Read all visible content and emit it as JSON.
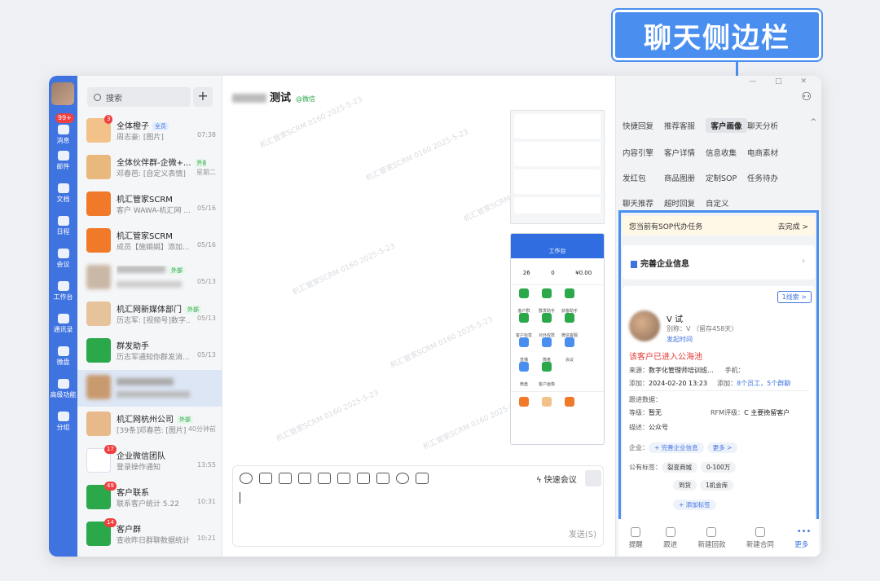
{
  "callout": "聊天侧边栏",
  "nav": {
    "badge": "99+",
    "items": [
      "消息",
      "邮件",
      "文档",
      "日程",
      "会议",
      "工作台",
      "通讯录",
      "微盘",
      "高级功能",
      "分组"
    ]
  },
  "chatlist": {
    "search_placeholder": "搜索",
    "plus": "+",
    "conversations": [
      {
        "name": "全体橙子",
        "tag": "全员",
        "preview": "周志豪: [图片]",
        "time": "07:38",
        "badge": "3"
      },
      {
        "name": "全体伙伴群-企微+...",
        "tag": "外部",
        "preview": "邓春芭: [自定义表情]",
        "time": "星期二",
        "badge": ""
      },
      {
        "name": "机汇管家SCRM",
        "tag": "",
        "preview": "客户 WAWA-机汇网 ...",
        "time": "05/16",
        "badge": ""
      },
      {
        "name": "机汇管家SCRM",
        "tag": "",
        "preview": "成员【施娟娟】添加...",
        "time": "05/16",
        "badge": ""
      },
      {
        "name": "",
        "tag": "外部",
        "preview": "",
        "time": "05/13",
        "badge": ""
      },
      {
        "name": "机汇网新媒体部门",
        "tag": "外部",
        "preview": "历志军: [视频号]数字...",
        "time": "05/13",
        "badge": ""
      },
      {
        "name": "群发助手",
        "tag": "",
        "preview": "历志军通知你群发消...",
        "time": "05/13",
        "badge": ""
      },
      {
        "name": "",
        "tag": "",
        "preview": "",
        "time": "",
        "badge": ""
      },
      {
        "name": "机汇网杭州公司",
        "tag": "外部",
        "preview": "[39条]邓春芭: [图片]",
        "time": "40分钟前",
        "badge": ""
      },
      {
        "name": "企业微信团队",
        "tag": "",
        "preview": "登录操作通知",
        "time": "13:55",
        "badge": "17"
      },
      {
        "name": "客户联系",
        "tag": "",
        "preview": "联系客户统计 5.22",
        "time": "10:31",
        "badge": "49"
      },
      {
        "name": "客户群",
        "tag": "",
        "preview": "查收昨日群聊数据统计",
        "time": "10:21",
        "badge": "14"
      }
    ]
  },
  "chat": {
    "title": "测试",
    "source": "@微信",
    "watermark": "机汇管家SCRM 0160 2025-5-23",
    "phone_header": "工作台",
    "phone_stats": [
      "26",
      "0",
      "¥0.00"
    ],
    "phone_apps": [
      "客户群",
      "群发助手",
      "获客助手",
      "客户标签",
      "对外收款",
      "微信客服",
      "直播",
      "微盘",
      "会议",
      "微盘",
      "客户画像",
      ""
    ],
    "quick_meeting": "快速会议",
    "send": "发送(S)"
  },
  "side": {
    "tabs": [
      "快捷回复",
      "推荐客服",
      "客户画像",
      "聊天分析",
      "内容引擎",
      "客户详情",
      "信息收集",
      "电商素材",
      "发红包",
      "商品图册",
      "定制SOP",
      "任务待办",
      "聊天推荐",
      "超时回复",
      "自定义"
    ],
    "active_tab": "客户画像",
    "sop_text": "您当前有SOP代办任务",
    "sop_action": "去完成 >",
    "complete_company": "完善企业信息",
    "onetoone": "1线索 >",
    "customer": {
      "name": "V      试",
      "alias": "别称：V       （留存458天）",
      "start_chat": "发起时间",
      "warning": "该客户已进入公海池",
      "source_label": "来源：",
      "source_value": "数字化管理师培训班...",
      "phone_label": "手机：",
      "add_label": "添加：",
      "add_value": "2024-02-20 13:23",
      "add2_label": "添加：",
      "add2_value": "8个员工，5个群聊",
      "follow_label": "跟进数据：",
      "level_label": "等级：",
      "level_value": "暂无",
      "rfm_label": "RFM评级：",
      "rfm_value": "C 主要挽留客户",
      "desc_label": "描述：",
      "desc_value": "公众号",
      "company_label": "企业：",
      "company_pill": "+ 完善企业信息",
      "more_pill": "更多 >",
      "tags_label": "公有标签：",
      "tags": [
        "裂变商城",
        "0-100万",
        "到货",
        "1机会库"
      ],
      "add_tag": "+ 添加标签"
    },
    "bottom": [
      "提醒",
      "跟进",
      "新建回款",
      "新建合同",
      "更多"
    ]
  }
}
